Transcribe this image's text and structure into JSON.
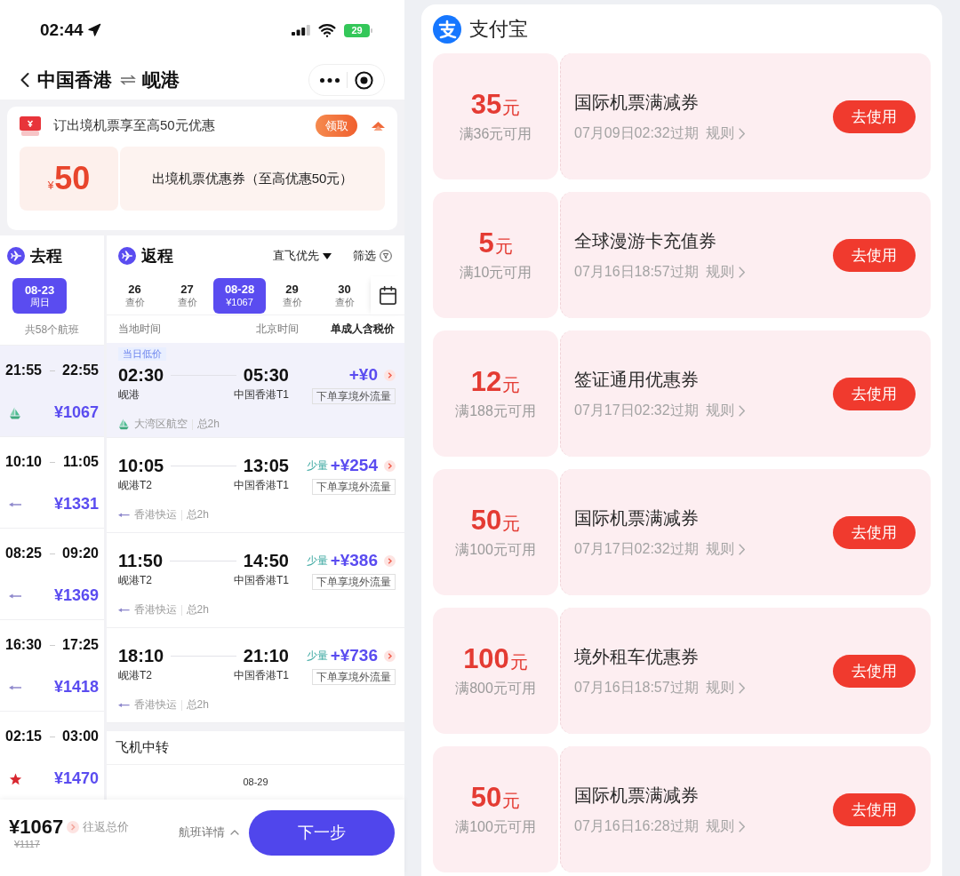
{
  "status_bar": {
    "time": "02:44",
    "battery": "29"
  },
  "nav_bar": {
    "origin": "中国香港",
    "destination": "岘港"
  },
  "promo": {
    "title": "订出境机票享至高50元优惠",
    "claim_button": "领取",
    "expanded": true,
    "coupon": {
      "currency": "¥",
      "amount": "50",
      "description": "出境机票优惠券（至高优惠50元）"
    }
  },
  "outbound": {
    "title": "去程",
    "date": {
      "date": "08-23",
      "weekday": "周日"
    },
    "count": "共58个航班",
    "flights": [
      {
        "depart": "21:55",
        "arrive": "22:55",
        "price": "¥1067",
        "kind": "sail",
        "selected": true
      },
      {
        "depart": "10:10",
        "arrive": "11:05",
        "price": "¥1331",
        "kind": "dart",
        "selected": false
      },
      {
        "depart": "08:25",
        "arrive": "09:20",
        "price": "¥1369",
        "kind": "dart",
        "selected": false
      },
      {
        "depart": "16:30",
        "arrive": "17:25",
        "price": "¥1418",
        "kind": "dart",
        "selected": false
      },
      {
        "depart": "02:15",
        "arrive": "03:00",
        "price": "¥1470",
        "kind": "star",
        "selected": false
      }
    ]
  },
  "return_trip": {
    "title": "返程",
    "sort": "直飞优先",
    "filter": "筛选",
    "dates": [
      {
        "day": "26",
        "price": "查价",
        "selected": false
      },
      {
        "day": "27",
        "price": "查价",
        "selected": false
      },
      {
        "day": "08-28",
        "price": "¥1067",
        "selected": true
      },
      {
        "day": "29",
        "price": "查价",
        "selected": false
      },
      {
        "day": "30",
        "price": "查价",
        "selected": false
      }
    ],
    "columns": [
      "当地时间",
      "北京时间",
      "单成人含税价"
    ],
    "flights": [
      {
        "badge": "当日低价",
        "depart": "02:30",
        "arrive": "05:30",
        "from": "岘港",
        "to": "中国香港T1",
        "price": "+¥0",
        "perk": "下单享境外流量",
        "airline": "大湾区航空",
        "duration": "总2h",
        "kind": "sail",
        "selected": true
      },
      {
        "depart": "10:05",
        "arrive": "13:05",
        "from": "岘港T2",
        "to": "中国香港T1",
        "stock": "少量",
        "price": "+¥254",
        "perk": "下单享境外流量",
        "airline": "香港快运",
        "duration": "总2h",
        "kind": "dart",
        "selected": false
      },
      {
        "depart": "11:50",
        "arrive": "14:50",
        "from": "岘港T2",
        "to": "中国香港T1",
        "stock": "少量",
        "price": "+¥386",
        "perk": "下单享境外流量",
        "airline": "香港快运",
        "duration": "总2h",
        "kind": "dart",
        "selected": false
      },
      {
        "depart": "18:10",
        "arrive": "21:10",
        "from": "岘港T2",
        "to": "中国香港T1",
        "stock": "少量",
        "price": "+¥736",
        "perk": "下单享境外流量",
        "airline": "香港快运",
        "duration": "总2h",
        "kind": "dart",
        "selected": false
      }
    ],
    "transfer": {
      "title": "飞机中转",
      "date": "08-29"
    }
  },
  "bottom_bar": {
    "total": "¥1067",
    "total_label": "往返总价",
    "original_price": "¥1117",
    "details": "航班详情",
    "next_button": "下一步"
  },
  "alipay": {
    "app_name": "支付宝",
    "coupons": [
      {
        "amount": "35",
        "unit": "元",
        "condition": "满36元可用",
        "title": "国际机票满减券",
        "expiry": "07月09日02:32过期",
        "rules": "规则",
        "button": "去使用"
      },
      {
        "amount": "5",
        "unit": "元",
        "condition": "满10元可用",
        "title": "全球漫游卡充值券",
        "expiry": "07月16日18:57过期",
        "rules": "规则",
        "button": "去使用"
      },
      {
        "amount": "12",
        "unit": "元",
        "condition": "满188元可用",
        "title": "签证通用优惠券",
        "expiry": "07月17日02:32过期",
        "rules": "规则",
        "button": "去使用"
      },
      {
        "amount": "50",
        "unit": "元",
        "condition": "满100元可用",
        "title": "国际机票满减券",
        "expiry": "07月17日02:32过期",
        "rules": "规则",
        "button": "去使用"
      },
      {
        "amount": "100",
        "unit": "元",
        "condition": "满800元可用",
        "title": "境外租车优惠券",
        "expiry": "07月16日18:57过期",
        "rules": "规则",
        "button": "去使用"
      },
      {
        "amount": "50",
        "unit": "元",
        "condition": "满100元可用",
        "title": "国际机票满减券",
        "expiry": "07月16日16:28过期",
        "rules": "规则",
        "button": "去使用"
      }
    ]
  }
}
